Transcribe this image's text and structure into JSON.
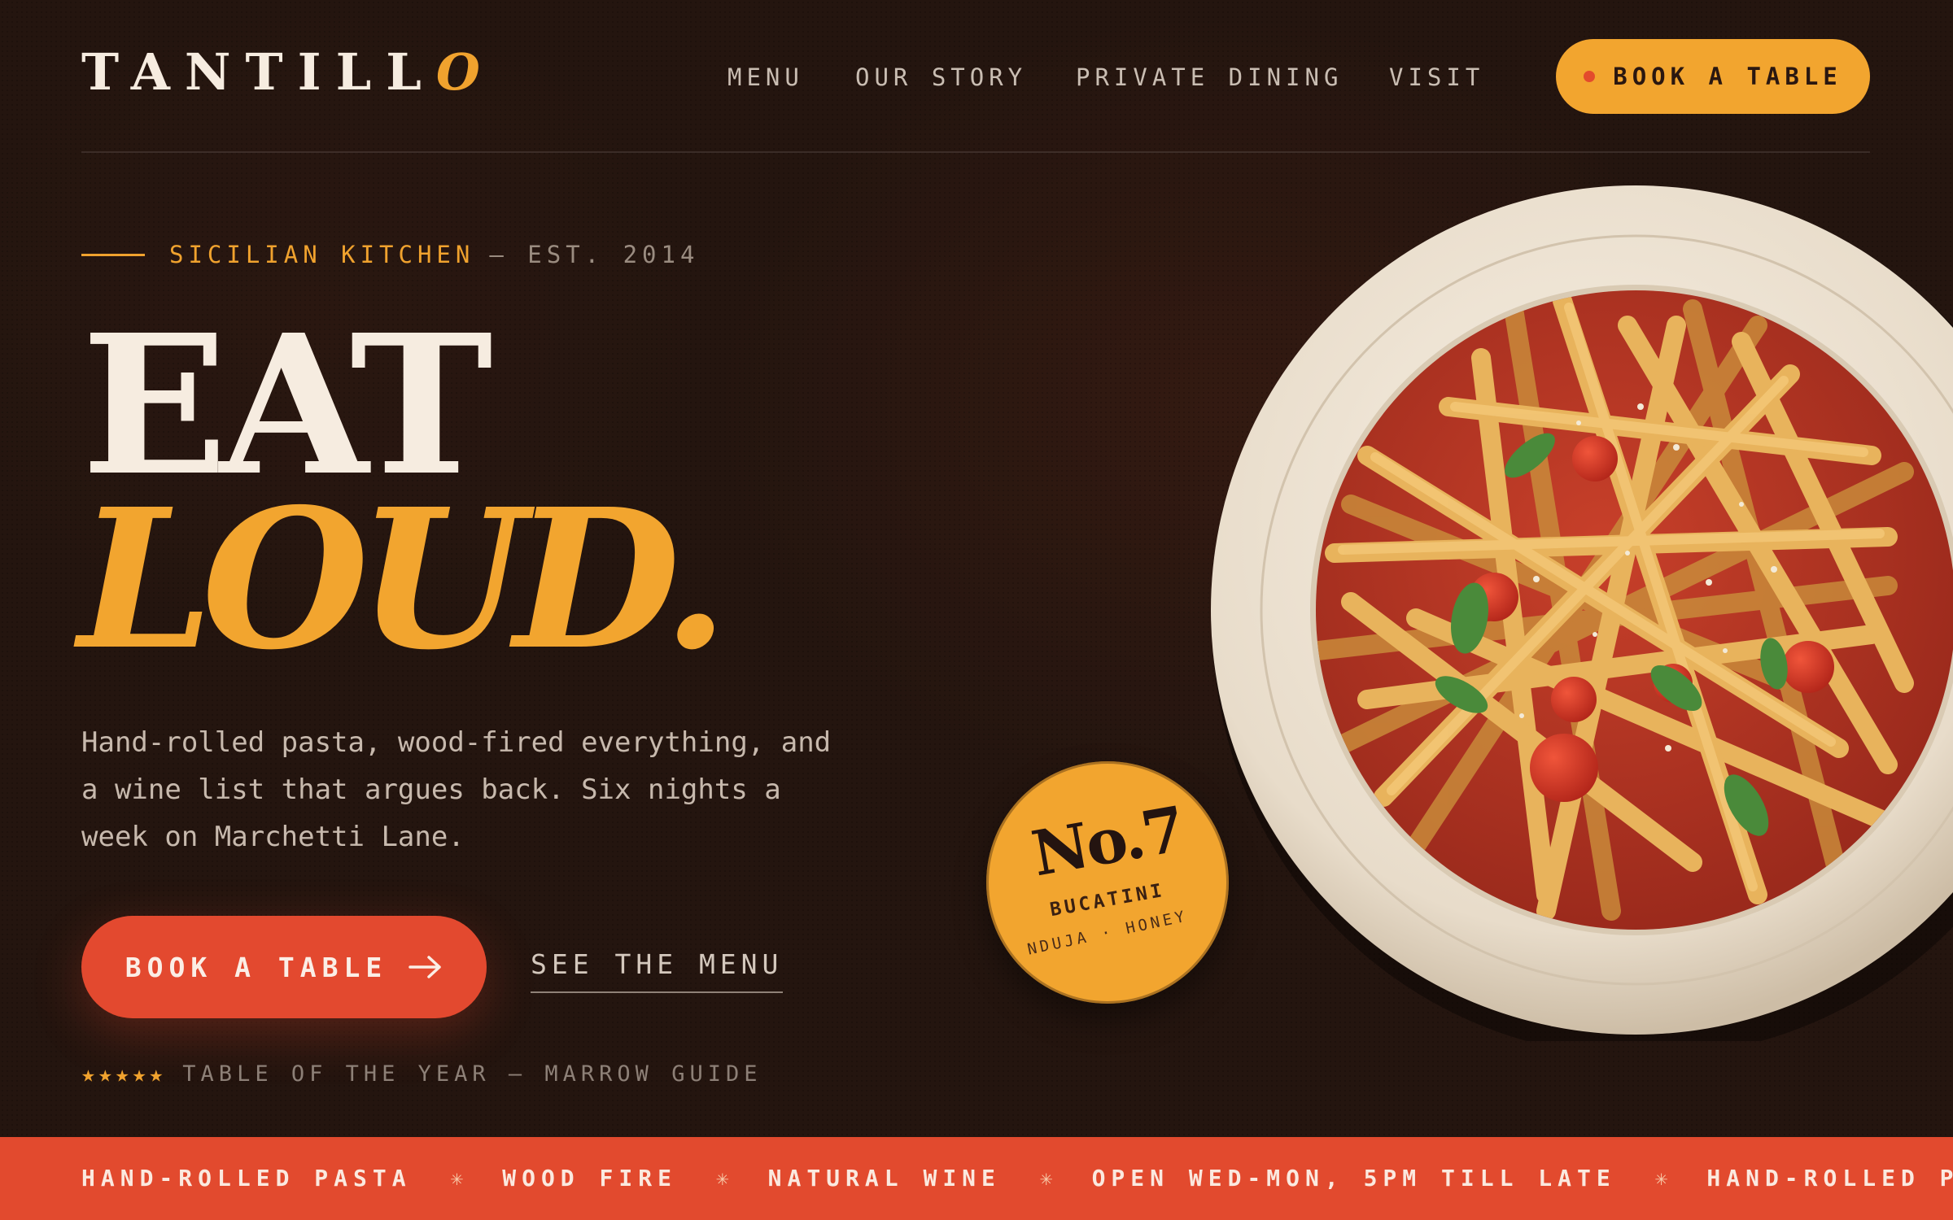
{
  "brand": {
    "logo_main": "TANTILL",
    "logo_accent": "O"
  },
  "nav": {
    "items": [
      {
        "label": "MENU"
      },
      {
        "label": "OUR STORY"
      },
      {
        "label": "PRIVATE DINING"
      },
      {
        "label": "VISIT"
      }
    ],
    "cta_label": "BOOK A TABLE"
  },
  "hero": {
    "eyebrow_accent": "SICILIAN KITCHEN",
    "eyebrow_muted": "— EST. 2014",
    "headline_line1": "EAT",
    "headline_line2": "LOUD.",
    "lede": "Hand-rolled pasta, wood-fired everything, and a wine list that argues back. Six nights a week on Marchetti Lane.",
    "primary_cta": "BOOK A TABLE",
    "secondary_cta": "SEE THE MENU",
    "award_stars": "★★★★★",
    "award_text": "TABLE OF THE YEAR — MARROW GUIDE"
  },
  "badge": {
    "number": "No.7",
    "dish": "BUCATINI",
    "ingredients": "NDUJA · HONEY"
  },
  "ticker": {
    "items": [
      "HAND-ROLLED PASTA",
      "WOOD FIRE",
      "NATURAL WINE",
      "OPEN WED-MON, 5PM TILL LATE",
      "HAND-ROLLED PASTA"
    ],
    "separator": "✳"
  },
  "colors": {
    "background": "#24150f",
    "accent_orange": "#f2a52f",
    "accent_red": "#e3492f",
    "cream": "#f6ece0"
  },
  "icons": {
    "primary_cta": "arrow-right-icon",
    "header_cta": "dot-icon"
  }
}
